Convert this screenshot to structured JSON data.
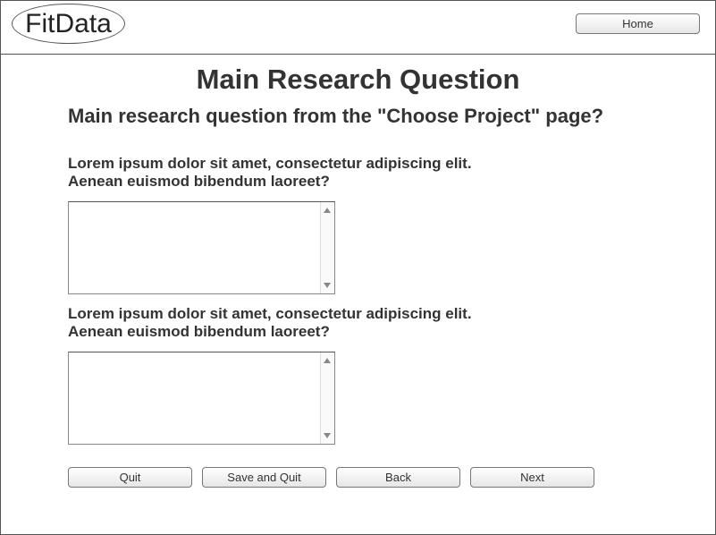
{
  "header": {
    "logo": "FitData",
    "home_label": "Home"
  },
  "main": {
    "title": "Main Research Question",
    "subtitle": "Main research question from the \"Choose Project\" page?",
    "questions": [
      {
        "line1": "Lorem ipsum dolor sit amet, consectetur adipiscing elit.",
        "line2": "Aenean euismod bibendum laoreet?",
        "answer": ""
      },
      {
        "line1": "Lorem ipsum dolor sit amet, consectetur adipiscing elit.",
        "line2": "Aenean euismod bibendum laoreet?",
        "answer": ""
      }
    ]
  },
  "actions": {
    "quit": "Quit",
    "save_quit": "Save and Quit",
    "back": "Back",
    "next": "Next"
  }
}
